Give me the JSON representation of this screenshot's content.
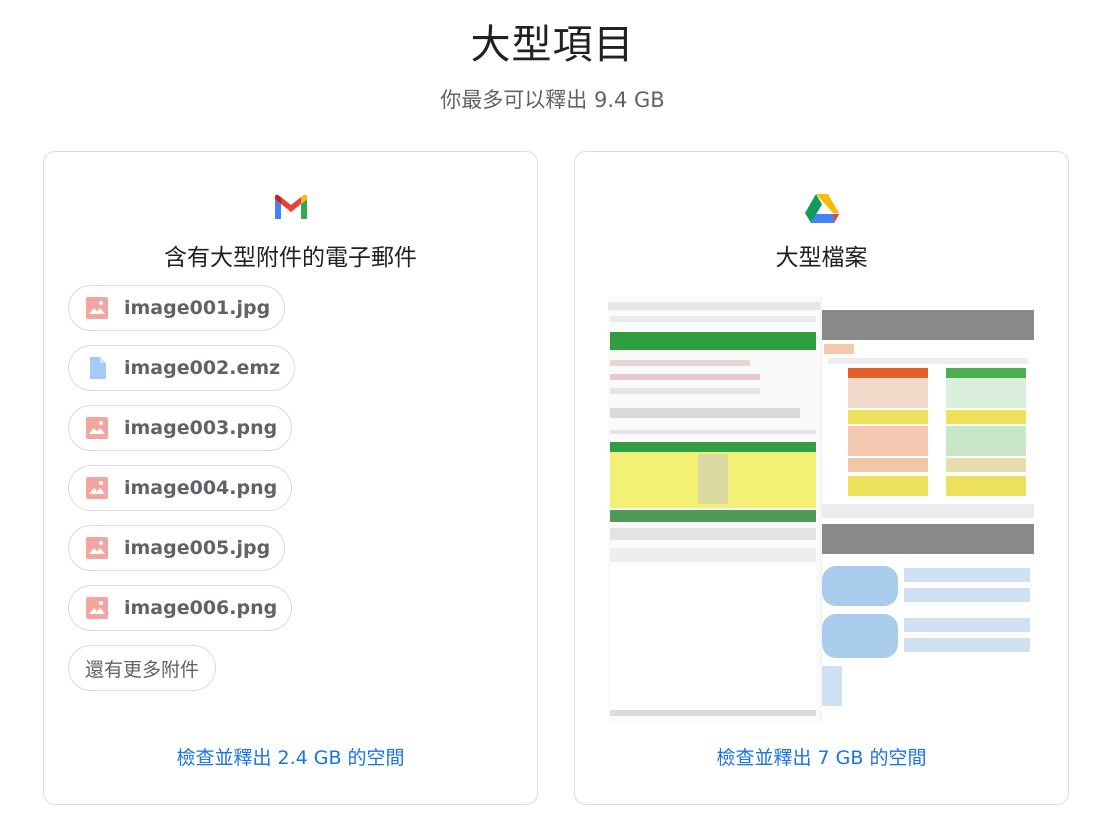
{
  "header": {
    "title": "大型項目",
    "subtitle": "你最多可以釋出 9.4 GB"
  },
  "gmail_card": {
    "icon": "gmail-icon",
    "title": "含有大型附件的電子郵件",
    "attachments": [
      {
        "name": "image001.jpg",
        "icon": "image-file-icon"
      },
      {
        "name": "image002.emz",
        "icon": "document-file-icon"
      },
      {
        "name": "image003.png",
        "icon": "image-file-icon"
      },
      {
        "name": "image004.png",
        "icon": "image-file-icon"
      },
      {
        "name": "image005.jpg",
        "icon": "image-file-icon"
      },
      {
        "name": "image006.png",
        "icon": "image-file-icon"
      }
    ],
    "more_label": "還有更多附件",
    "link": "檢查並釋出 2.4 GB 的空間"
  },
  "drive_card": {
    "icon": "google-drive-icon",
    "title": "大型檔案",
    "link": "檢查並釋出 7 GB 的空間"
  },
  "colors": {
    "link": "#1a73e8",
    "image_icon": "#f2a6a0",
    "doc_icon": "#a8c7fa",
    "border": "#dadce0"
  }
}
